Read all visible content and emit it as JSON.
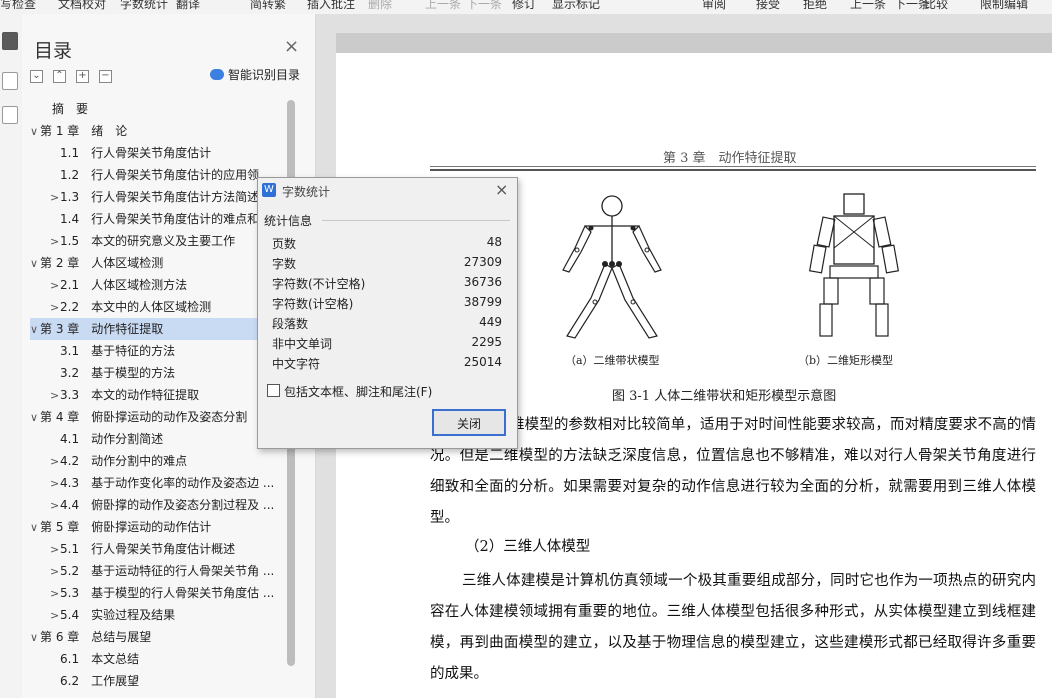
{
  "ribbon": {
    "items": [
      "写检查",
      "文档校对",
      "字数统计",
      "翻译",
      "简转繁",
      "插入批注",
      "删除",
      "上一条",
      "下一条",
      "修订",
      "显示标记",
      "审阅",
      "接受",
      "拒绝",
      "上一条",
      "下一条",
      "比较",
      "限制编辑"
    ]
  },
  "toc": {
    "title": "目录",
    "close": "×",
    "smart_label": "智能识别目录",
    "items": [
      {
        "text": "摘　要",
        "arrow": ""
      },
      {
        "text": "第 1 章　绪　论",
        "arrow": "∨"
      },
      {
        "text": "1.1　行人骨架关节角度估计",
        "arrow": ""
      },
      {
        "text": "1.2　行人骨架关节角度估计的应用领",
        "arrow": ""
      },
      {
        "text": "1.3　行人骨架关节角度估计方法简述",
        "arrow": ">"
      },
      {
        "text": "1.4　行人骨架关节角度估计的难点和",
        "arrow": ""
      },
      {
        "text": "1.5　本文的研究意义及主要工作",
        "arrow": ">"
      },
      {
        "text": "第 2 章　人体区域检测",
        "arrow": "∨"
      },
      {
        "text": "2.1　人体区域检测方法",
        "arrow": ">"
      },
      {
        "text": "2.2　本文中的人体区域检测",
        "arrow": ">"
      },
      {
        "text": "第 3 章　动作特征提取",
        "arrow": "∨"
      },
      {
        "text": "3.1　基于特征的方法",
        "arrow": ""
      },
      {
        "text": "3.2　基于模型的方法",
        "arrow": ""
      },
      {
        "text": "3.3　本文的动作特征提取",
        "arrow": ">"
      },
      {
        "text": "第 4 章　俯卧撑运动的动作及姿态分割",
        "arrow": "∨"
      },
      {
        "text": "4.1　动作分割简述",
        "arrow": ""
      },
      {
        "text": "4.2　动作分割中的难点",
        "arrow": ">"
      },
      {
        "text": "4.3　基于动作变化率的动作及姿态边 ...",
        "arrow": ">"
      },
      {
        "text": "4.4　俯卧撑的动作及姿态分割过程及 ...",
        "arrow": ">"
      },
      {
        "text": "第 5 章　俯卧撑运动的动作估计",
        "arrow": "∨"
      },
      {
        "text": "5.1　行人骨架关节角度估计概述",
        "arrow": ">"
      },
      {
        "text": "5.2　基于运动特征的行人骨架关节角 ...",
        "arrow": ">"
      },
      {
        "text": "5.3　基于模型的行人骨架关节角度估 ...",
        "arrow": ">"
      },
      {
        "text": "5.4　实验过程及结果",
        "arrow": ">"
      },
      {
        "text": "第 6 章　总结与展望",
        "arrow": "∨"
      },
      {
        "text": "6.1　本文总结",
        "arrow": ""
      },
      {
        "text": "6.2　工作展望",
        "arrow": ""
      }
    ],
    "selected_index": 10
  },
  "document": {
    "header": "第 3 章　动作特征提取",
    "caption_a": "（a）二维带状模型",
    "caption_b": "（b）二维矩形模型",
    "figure_caption": "图 3-1 人体二维带状和矩形模型示意图",
    "para1": "维模型的参数相对比较简单，适用于对时间性能要求较高，而对精度要求不高的情况。但是二维模型的方法缺乏深度信息，位置信息也不够精准，难以对行人骨架关节角度进行细致和全面的分析。如果需要对复杂的动作信息进行较为全面的分析，就需要用到三维人体模型。",
    "subheading": "（2）三维人体模型",
    "para2": "三维人体建模是计算机仿真领域一个极其重要组成部分，同时它也作为一项热点的研究内容在人体建模领域拥有重要的地位。三维人体模型包括很多种形式，从实体模型建立到线框建模，再到曲面模型的建立，以及基于物理信息的模型建立，这些建模形式都已经取得许多重要的成果。"
  },
  "dialog": {
    "title": "字数统计",
    "group_label": "统计信息",
    "stats": [
      {
        "label": "页数",
        "value": "48"
      },
      {
        "label": "字数",
        "value": "27309"
      },
      {
        "label": "字符数(不计空格)",
        "value": "36736"
      },
      {
        "label": "字符数(计空格)",
        "value": "38799"
      },
      {
        "label": "段落数",
        "value": "449"
      },
      {
        "label": "非中文单词",
        "value": "2295"
      },
      {
        "label": "中文字符",
        "value": "25014"
      }
    ],
    "checkbox_label": "包括文本框、脚注和尾注(F)",
    "checkbox_checked": false,
    "close_button": "关闭"
  }
}
